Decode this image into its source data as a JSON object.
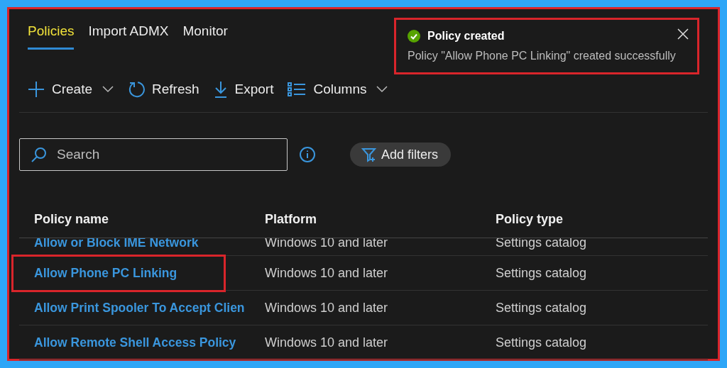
{
  "tabs": [
    {
      "label": "Policies",
      "selected": true
    },
    {
      "label": "Import ADMX",
      "selected": false
    },
    {
      "label": "Monitor",
      "selected": false
    }
  ],
  "toolbar": [
    {
      "kind": "create",
      "label": "Create",
      "dropdown": true
    },
    {
      "kind": "refresh",
      "label": "Refresh",
      "dropdown": false
    },
    {
      "kind": "export",
      "label": "Export",
      "dropdown": false
    },
    {
      "kind": "columns",
      "label": "Columns",
      "dropdown": true
    }
  ],
  "search": {
    "placeholder": "Search"
  },
  "filter_button": "Add filters",
  "table": {
    "columns": [
      "Policy name",
      "Platform",
      "Policy type"
    ],
    "rows": [
      {
        "cells": [
          "Allow or Block IME Network",
          "Windows 10 and later",
          "Settings catalog"
        ],
        "partial": true,
        "highlighted": false
      },
      {
        "cells": [
          "Allow Phone PC Linking",
          "Windows 10 and later",
          "Settings catalog"
        ],
        "partial": false,
        "highlighted": true
      },
      {
        "cells": [
          "Allow Print Spooler To Accept Clien",
          "Windows 10 and later",
          "Settings catalog"
        ],
        "partial": false,
        "highlighted": false
      },
      {
        "cells": [
          "Allow Remote Shell Access Policy",
          "Windows 10 and later",
          "Settings catalog"
        ],
        "partial": false,
        "highlighted": false
      }
    ]
  },
  "toast": {
    "title": "Policy created",
    "message": "Policy \"Allow Phone PC Linking\" created successfully",
    "highlighted": true
  }
}
